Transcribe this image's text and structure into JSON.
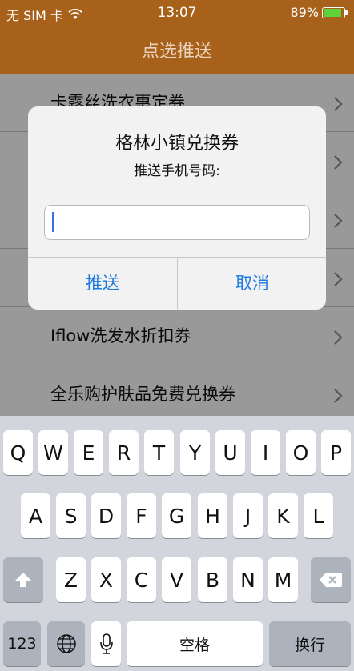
{
  "status": {
    "carrier": "无 SIM 卡",
    "time": "13:07",
    "battery_percent_text": "89%",
    "battery_level": 0.89
  },
  "nav": {
    "title": "点选推送"
  },
  "list": {
    "items": [
      "卡露丝洗衣惠定券",
      "",
      "",
      "",
      "Iflow洗发水折扣券",
      "全乐购护肤品免费兑换券"
    ]
  },
  "alert": {
    "title": "格林小镇兑换券",
    "message": "推送手机号码:",
    "input_value": "",
    "push_label": "推送",
    "cancel_label": "取消"
  },
  "keyboard": {
    "row1": [
      "Q",
      "W",
      "E",
      "R",
      "T",
      "Y",
      "U",
      "I",
      "O",
      "P"
    ],
    "row2": [
      "A",
      "S",
      "D",
      "F",
      "G",
      "H",
      "J",
      "K",
      "L"
    ],
    "row3": [
      "Z",
      "X",
      "C",
      "V",
      "B",
      "N",
      "M"
    ],
    "numbers_label": "123",
    "space_label": "空格",
    "return_label": "换行"
  },
  "colors": {
    "nav_background": "#a8611b",
    "accent_blue": "#1f7ae0",
    "battery_green": "#5fd33b"
  }
}
